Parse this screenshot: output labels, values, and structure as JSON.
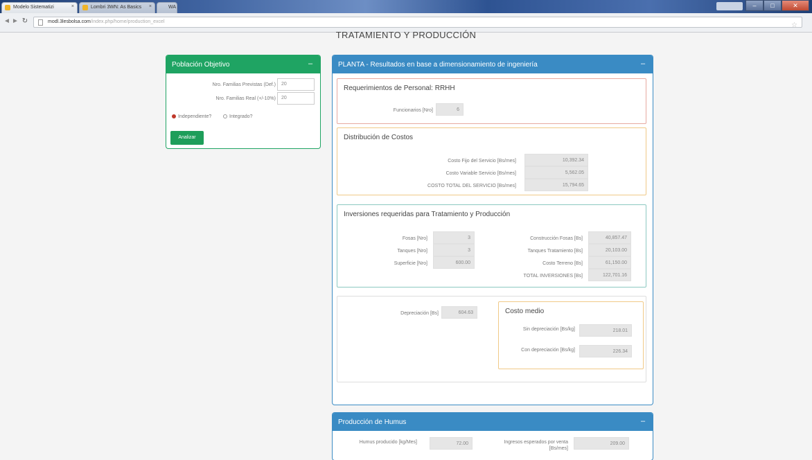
{
  "browser": {
    "tabs": [
      {
        "label": "Modelo Sistematizi"
      },
      {
        "label": "Lombri 3WN: As Basics"
      },
      {
        "label": "WA"
      }
    ],
    "user_badge": "",
    "url_host": "modl.3lesbolsa.com",
    "url_path": "/index.php/home/production_excel"
  },
  "page": {
    "title": "TRATAMIENTO Y PRODUCCIÓN"
  },
  "poblacion": {
    "header": "Población Objetivo",
    "fields": [
      {
        "label": "Nro. Familias Previstas (Def.)",
        "value": "20"
      },
      {
        "label": "Nro. Familias Real (+/-10%)",
        "value": "20"
      }
    ],
    "radio_independiente": "Independiente?",
    "radio_integrado": "Integrado?",
    "submit_label": "Analizar"
  },
  "planta": {
    "header": "PLANTA - Resultados en base a dimensionamiento de ingeniería",
    "rrhh": {
      "title": "Requerimientos de Personal: RRHH",
      "label": "Funcionarios [Nro]",
      "value": "6"
    },
    "costos": {
      "title": "Distribución de Costos",
      "rows": [
        {
          "label": "Costo Fijo del Servicio [Bs/mes]",
          "value": "10,392.34"
        },
        {
          "label": "Costo Variable Servicio [Bs/mes]",
          "value": "5,562.05"
        },
        {
          "label": "COSTO TOTAL DEL SERVICIO [Bs/mes]",
          "value": "15,794.65"
        }
      ]
    },
    "inversiones": {
      "title": "Inversiones requeridas para Tratamiento y Producción",
      "left": [
        {
          "label": "Fosas [Nro]",
          "value": "3"
        },
        {
          "label": "Tanques [Nro]",
          "value": "3"
        },
        {
          "label": "Superficie [Nro]",
          "value": "600.00"
        }
      ],
      "right": [
        {
          "label": "Construcción Fosas [Bs]",
          "value": "40,857.47"
        },
        {
          "label": "Tanques Tratamiento [Bs]",
          "value": "20,103.00"
        },
        {
          "label": "Costo Terreno [Bs]",
          "value": "61,150.00"
        },
        {
          "label": "TOTAL INVERSIONES [Bs]",
          "value": "122,701.16"
        }
      ]
    },
    "depreciacion": {
      "label": "Depreciación [Bs]",
      "value": "604.63"
    },
    "costo_medio": {
      "title": "Costo medio",
      "rows": [
        {
          "label": "Sin depreciación [Bs/kg]",
          "value": "218.01"
        },
        {
          "label": "Con depreciación [Bs/kg]",
          "value": "226.34"
        }
      ]
    }
  },
  "humus": {
    "header": "Producción de Humus",
    "rows": [
      {
        "label": "Humus producido [kg/Mes]",
        "value": "72.00"
      },
      {
        "label": "Ingresos esperados por venta [Bs/mes]",
        "value": "209.00"
      }
    ]
  }
}
